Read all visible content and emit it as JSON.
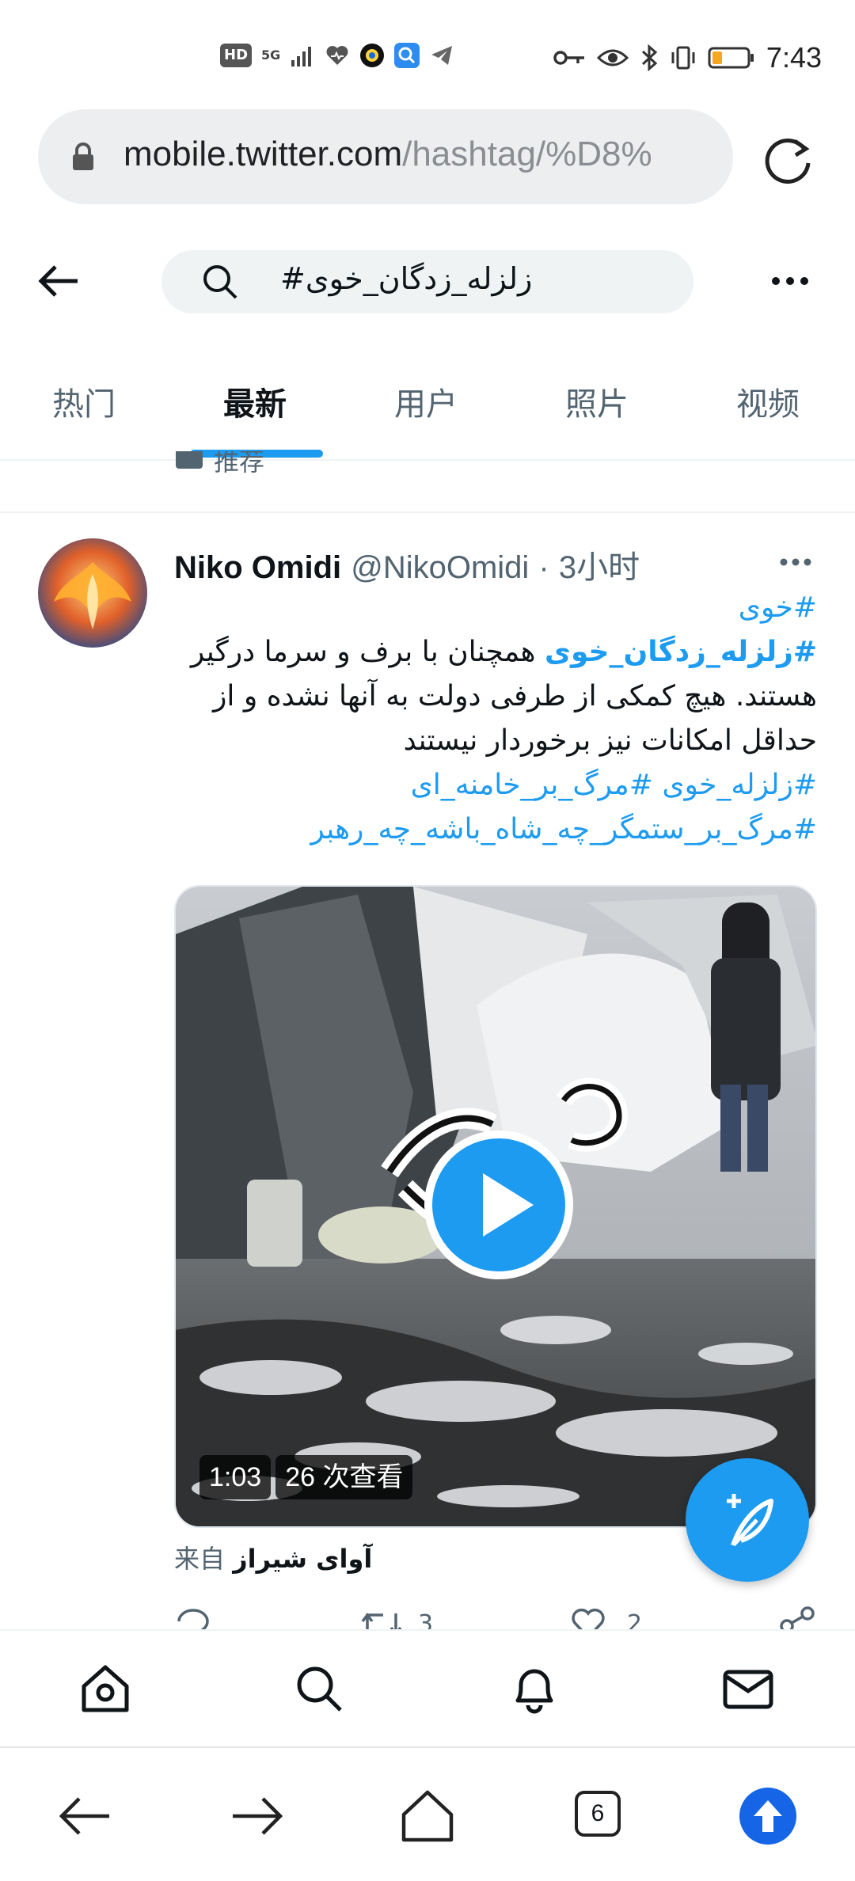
{
  "status_bar": {
    "network_chip": "HD",
    "signal_label": "5G",
    "time": "7:43"
  },
  "browser": {
    "url_host": "mobile.twitter.com",
    "url_path": "/hashtag/%D8%",
    "tab_count": "6"
  },
  "search": {
    "query": "#زلزله_زدگان_خوی"
  },
  "tabs": [
    {
      "label": "热门",
      "active": false
    },
    {
      "label": "最新",
      "active": true
    },
    {
      "label": "用户",
      "active": false
    },
    {
      "label": "照片",
      "active": false
    },
    {
      "label": "视频",
      "active": false
    }
  ],
  "promo_peek": "推荐",
  "tweet": {
    "name": "Niko Omidi",
    "handle": "@NikoOmidi",
    "separator": "·",
    "time": "3小时",
    "body": {
      "line1_tag": "#خوی",
      "line2_tag": "#زلزله_زدگان_خوی",
      "line2_text": " همچنان با برف و سرما درگیر",
      "line3": "هستند. هیچ کمکی از طرفی دولت به آنها نشده و از",
      "line4": "حداقل امکانات نیز برخوردار نیستند",
      "line5_tag1": "#زلزله_خوی",
      "line5_tag2": "#مرگ_بر_خامنه_ای",
      "line6_tag": "#مرگ_بر_ستمگر_چه_شاه_باشه_چه_رهبر"
    },
    "video": {
      "duration": "1:03",
      "views": "26 次查看"
    },
    "source_prefix": "来自",
    "source_name": "آوای شیراز",
    "retweets": "3",
    "likes": "2"
  },
  "colors": {
    "accent": "#1d9bf0",
    "text_primary": "#0f1419",
    "text_secondary": "#536471"
  }
}
